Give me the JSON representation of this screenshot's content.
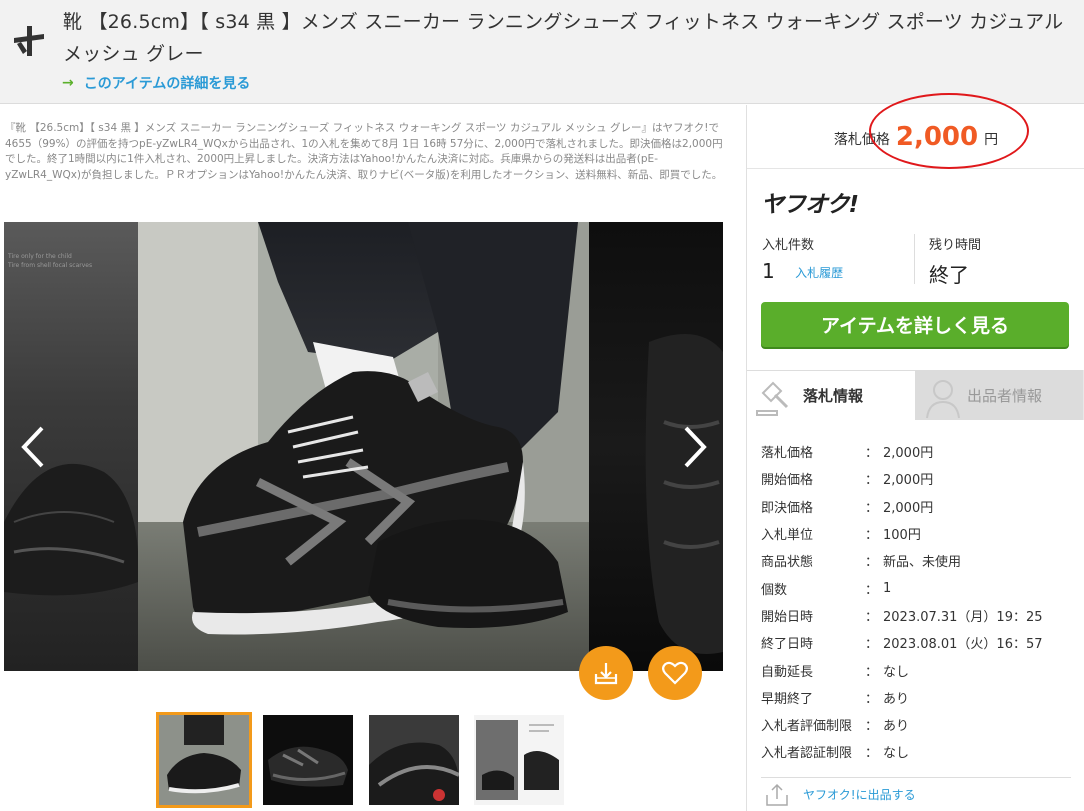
{
  "header": {
    "title": "靴 【26.5cm】【 s34 黒 】メンズ スニーカー ランニングシューズ フィットネス ウォーキング スポーツ カジュアル メッシュ グレー",
    "detail_link": "このアイテムの詳細を見る",
    "logo_icon": "aucfan-logo-icon"
  },
  "description": "『靴 【26.5cm】【 s34 黒 】メンズ スニーカー ランニングシューズ フィットネス ウォーキング スポーツ カジュアル メッシュ グレー』はヤフオク!で4655（99%）の評価を持つpE-yZwLR4_WQxから出品され、1の入札を集めて8月 1日 16時 57分に、2,000円で落札されました。即決価格は2,000円でした。終了1時間以内に1件入札され、2000円上昇しました。決済方法はYahoo!かんたん決済に対応。兵庫県からの発送料は出品者(pE-yZwLR4_WQx)が負担しました。ＰＲオプションはYahoo!かんたん決済、取りナビ(ベータ版)を利用したオークション、送料無料、新品、即買でした。",
  "gallery": {
    "side_text": "Tire only for the child\nTire from shell focal scarves",
    "prev_icon": "chevron-left-icon",
    "next_icon": "chevron-right-icon",
    "share_icon": "download-tray-icon",
    "favorite_icon": "heart-icon",
    "thumbnail_count": 4,
    "active_thumbnail": 1
  },
  "price": {
    "label": "落札価格",
    "value": "2,000",
    "unit": "円",
    "color": "#f05a24"
  },
  "yahoo": {
    "logo": "ヤフオク!",
    "bids_label": "入札件数",
    "bids_value": "1",
    "history_link": "入札履歴",
    "time_label": "残り時間",
    "time_value": "終了",
    "cta": "アイテムを詳しく見る",
    "cta_color": "#5aae2b"
  },
  "tabs": [
    {
      "label": "落札情報",
      "icon": "gavel-icon",
      "active": true
    },
    {
      "label": "出品者情報",
      "icon": "user-icon",
      "active": false
    }
  ],
  "info": [
    {
      "k": "落札価格",
      "v": "2,000円"
    },
    {
      "k": "開始価格",
      "v": "2,000円"
    },
    {
      "k": "即決価格",
      "v": "2,000円"
    },
    {
      "k": "入札単位",
      "v": "100円"
    },
    {
      "k": "商品状態",
      "v": "新品、未使用"
    },
    {
      "k": "個数",
      "v": "1"
    },
    {
      "k": "開始日時",
      "v": "2023.07.31（月）19：25"
    },
    {
      "k": "終了日時",
      "v": "2023.08.01（火）16：57"
    },
    {
      "k": "自動延長",
      "v": "なし"
    },
    {
      "k": "早期終了",
      "v": "あり"
    },
    {
      "k": "入札者評価制限",
      "v": "あり"
    },
    {
      "k": "入札者認証制限",
      "v": "なし"
    }
  ],
  "info_separator": "：",
  "footer_link": "ヤフオク!に出品する",
  "footer_icon": "upload-box-icon",
  "accent_orange": "#f39a1a",
  "link_blue": "#2a9ad6"
}
